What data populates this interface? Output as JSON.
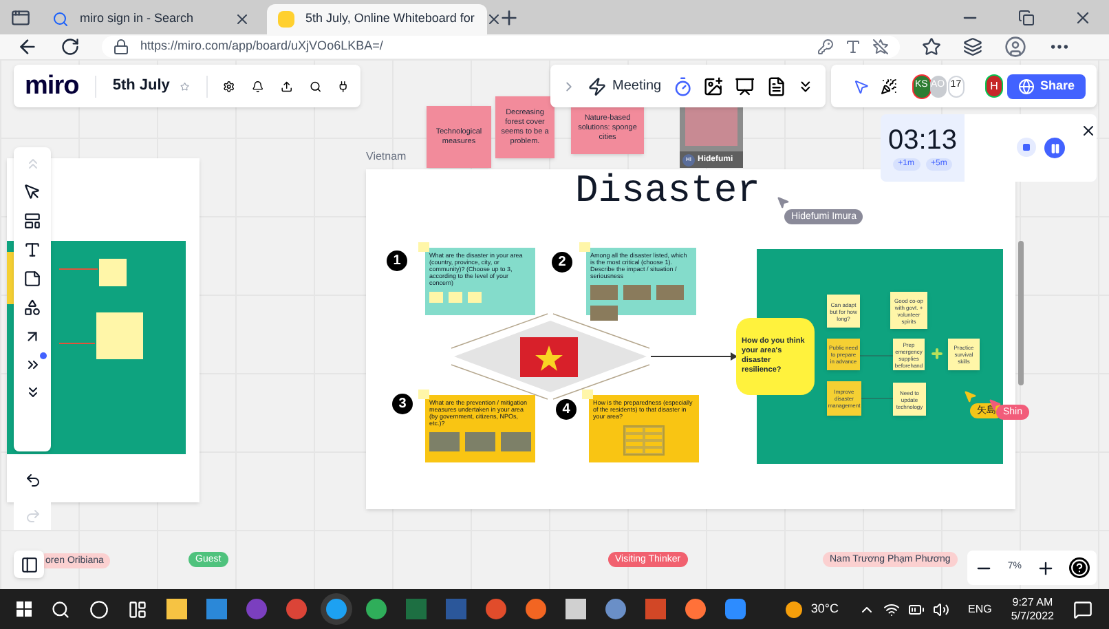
{
  "browser": {
    "tabs": [
      {
        "title": "miro sign in - Search",
        "selected": false
      },
      {
        "title": "5th July, Online Whiteboard for",
        "selected": true
      }
    ],
    "url": "https://miro.com/app/board/uXjVOo6LKBA=/"
  },
  "toolbar": {
    "logo": "miro",
    "board_name": "5th July",
    "meeting": "Meeting",
    "avatars": [
      {
        "initials": "KS",
        "color": "#2e7d32"
      },
      {
        "initials": "AO",
        "color": "#c9ccd1"
      }
    ],
    "participant_count": "17",
    "user_initial": "H",
    "share": "Share"
  },
  "timer": {
    "time": "03:13",
    "add_buttons": [
      "+1m",
      "+5m"
    ]
  },
  "board": {
    "top_notes": [
      {
        "text": "Technological measures",
        "color": "#f28b9b"
      },
      {
        "text": "Decreasing forest cover seems to be a problem.",
        "color": "#f28b9b"
      },
      {
        "text": "Nature-based solutions: sponge cities",
        "color": "#f28b9b"
      }
    ],
    "video_tile": {
      "initials": "HI",
      "name": "Hidefumi"
    },
    "frame": {
      "label": "Vietnam",
      "title": "Disaster"
    },
    "quadrants": [
      {
        "number": "1",
        "question": "What are the disaster in your area (country, province, city, or community)? (Choose up to 3, according to the level of your concern)",
        "color": "#84dccb"
      },
      {
        "number": "2",
        "question": "Among all the disaster listed, which is the most critical (choose 1). Describe the impact / situation / seriousness",
        "color": "#84dccb"
      },
      {
        "number": "3",
        "question": "What are the prevention / mitigation measures undertaken in your area (by government, citizens, NPOs, etc.)?",
        "color": "#f9c513"
      },
      {
        "number": "4",
        "question": "How is the preparedness (especially of the residents) to that disaster in your area?",
        "color": "#f9c513"
      }
    ],
    "question": "How do you think your area's disaster resilience?",
    "answers": [
      {
        "text": "Can adapt but for how long?",
        "color": "#fff6a8"
      },
      {
        "text": "Good co-op with govt. + volunteer spirits",
        "color": "#fff6a8"
      },
      {
        "text": "Public need to prepare in advance",
        "color": "#f5d033"
      },
      {
        "text": "Prep emergency supplies beforehand",
        "color": "#fff6a8"
      },
      {
        "text": "Practice survival skills",
        "color": "#fff6a8"
      },
      {
        "text": "Improve disaster management",
        "color": "#f5d033"
      },
      {
        "text": "Need to update technology",
        "color": "#fff6a8"
      }
    ],
    "cursors": [
      {
        "name": "Hidefumi Imura",
        "color": "#8a8a99"
      },
      {
        "name": "矢島",
        "color": "#f5c518"
      },
      {
        "name": "Shin",
        "color": "#f25c7a"
      }
    ],
    "name_tags": [
      {
        "name": "oren Oribiana",
        "color": "#fbd0d0"
      },
      {
        "name": "Guest",
        "color": "#4fc27d"
      },
      {
        "name": "Visiting Thinker",
        "color": "#f1616f"
      },
      {
        "name": "Nam Trương Phạm Phương",
        "color": "#fbd0d0"
      }
    ]
  },
  "zoom": "7%",
  "taskbar": {
    "weather": "30°C",
    "language": "ENG",
    "time": "9:27 AM",
    "date": "5/7/2022"
  }
}
